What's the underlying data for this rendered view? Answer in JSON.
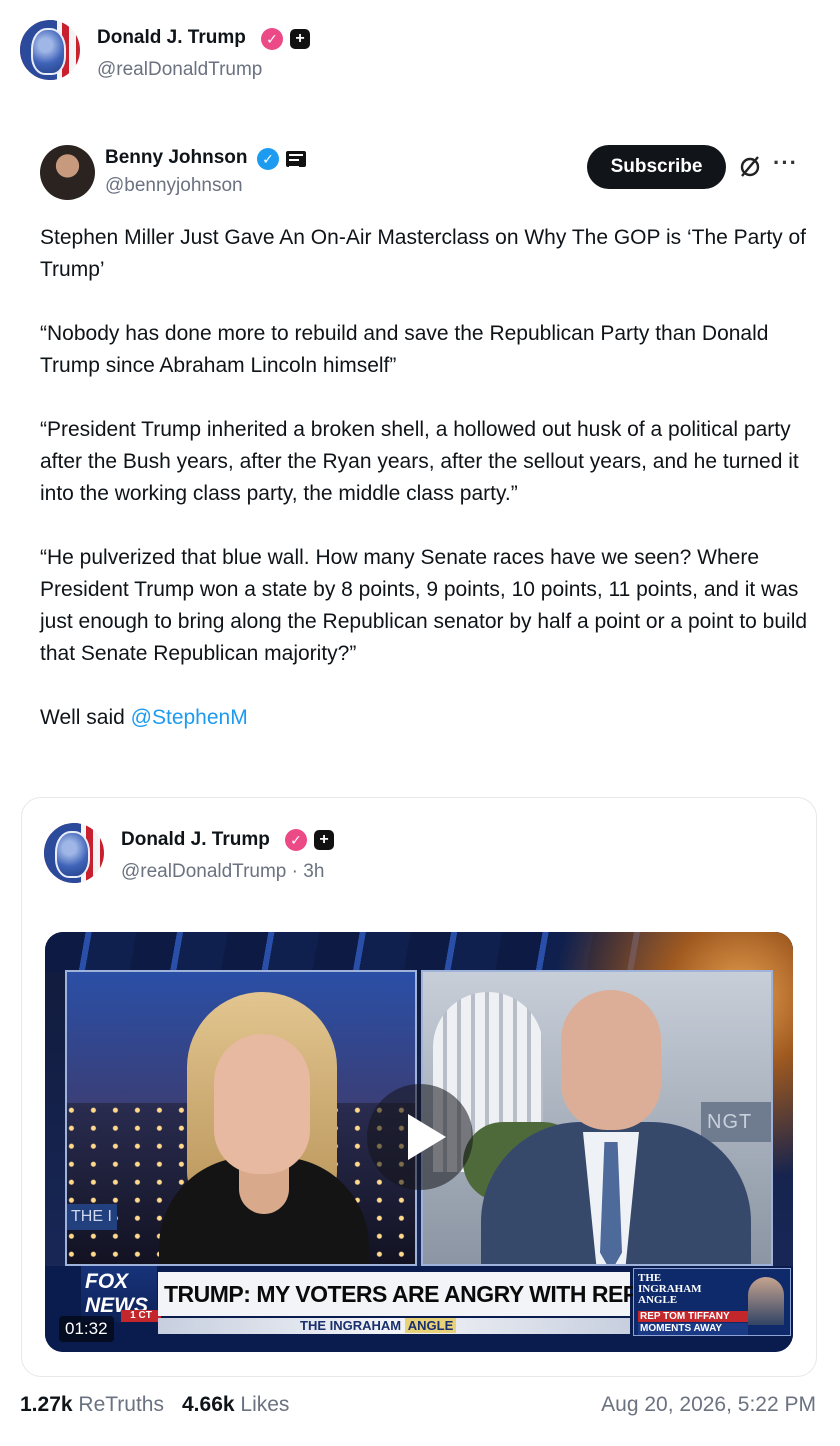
{
  "post": {
    "author": {
      "name": "Donald J. Trump",
      "handle": "@realDonaldTrump"
    }
  },
  "quoted_post": {
    "author": {
      "name": "Benny Johnson",
      "handle": "@bennyjohnson"
    },
    "subscribe_label": "Subscribe",
    "paragraphs": [
      "Stephen Miller Just Gave An On-Air Masterclass on Why The GOP is ‘The Party of Trump’",
      "“Nobody has done more to rebuild and save the Republican Party than Donald Trump since Abraham Lincoln himself”",
      "“President Trump inherited a broken shell, a hollowed out husk of a political party after the Bush years, after the Ryan years, after the sellout years, and he turned it into the working class party, the middle class party.”",
      "“He pulverized that blue wall. How many Senate races have we seen? Where President Trump won a state by 8 points, 9 points, 10 points, 11 points, and it was just enough to bring along the Republican senator by half a point or a point to build that Senate Republican majority?”"
    ],
    "closing_text": "Well said ",
    "mention": "@StephenM"
  },
  "embedded_post": {
    "author": {
      "name": "Donald J. Trump",
      "handle_time": "@realDonaldTrump · 3h"
    },
    "video": {
      "chyron": "TRUMP: MY VOTERS ARE ANGRY WITH REPUBLICANS",
      "network_logo_top": "FOX",
      "network_logo_bottom": "NEWS",
      "network_logo_tag": "1 CT",
      "show_name": "THE INGRAHAM",
      "show_name_accent": "ANGLE",
      "left_panel_tag": "THE I",
      "right_panel_wall": "NGT",
      "promo_title_1": "THE",
      "promo_title_2": "INGRAHAM",
      "promo_title_3": "ANGLE",
      "promo_line_1": "REP TOM TIFFANY",
      "promo_line_2": "MOMENTS AWAY",
      "duration": "01:32"
    }
  },
  "stats": {
    "retruths_count": "1.27k",
    "retruths_label": "ReTruths",
    "likes_count": "4.66k",
    "likes_label": "Likes",
    "timestamp": "Aug 20, 2026, 5:22 PM"
  },
  "colors": {
    "verified_pink": "#ec4a86",
    "verified_blue": "#1d9bf0",
    "mention": "#1d9bf0",
    "muted_text": "#6b7280"
  },
  "icons": {
    "verified_pink": "verified-badge-icon",
    "verified_blue": "verified-badge-icon",
    "plus": "plus-square-icon",
    "news": "newspaper-icon",
    "mute": "mute-icon",
    "more": "more-icon",
    "play": "play-icon"
  }
}
